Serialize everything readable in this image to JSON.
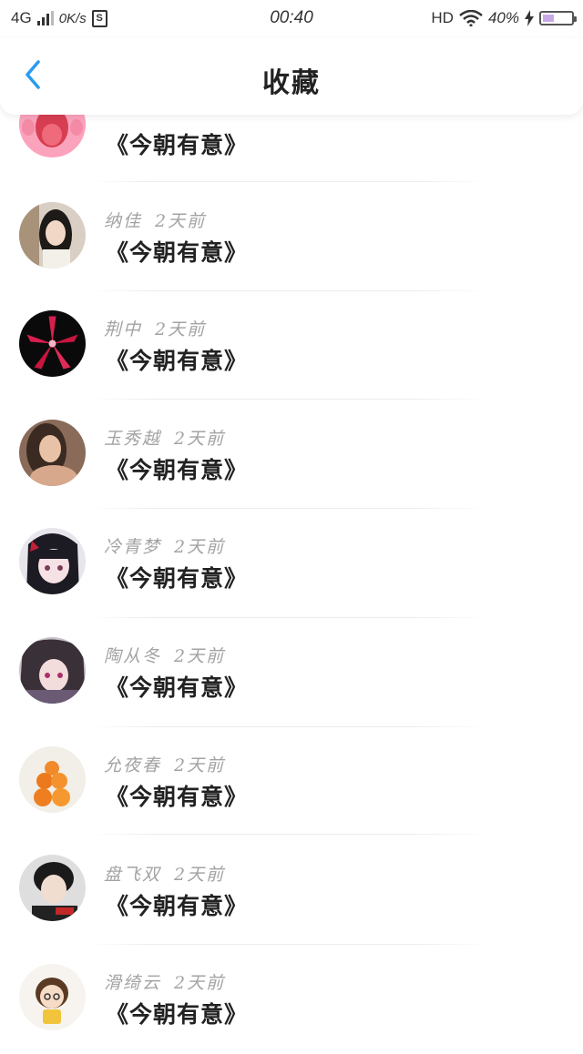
{
  "status_bar": {
    "network": "4G",
    "speed": "0K/s",
    "sim": "S",
    "time": "00:40",
    "hd": "HD",
    "battery": "40%",
    "battery_level": 0.4
  },
  "header": {
    "title": "收藏",
    "back_icon": "chevron-left-icon",
    "accent_color": "#2a9bf0"
  },
  "items": [
    {
      "user": "",
      "time": "",
      "title": "《今朝有意》",
      "avatar": "pink-round-character"
    },
    {
      "user": "纳佳",
      "time": "2天前",
      "title": "《今朝有意》",
      "avatar": "woman-portrait"
    },
    {
      "user": "荆中",
      "time": "2天前",
      "title": "《今朝有意》",
      "avatar": "red-lily-flower"
    },
    {
      "user": "玉秀越",
      "time": "2天前",
      "title": "《今朝有意》",
      "avatar": "woman-portrait"
    },
    {
      "user": "冷青梦",
      "time": "2天前",
      "title": "《今朝有意》",
      "avatar": "anime-girl"
    },
    {
      "user": "陶从冬",
      "time": "2天前",
      "title": "《今朝有意》",
      "avatar": "anime-girl"
    },
    {
      "user": "允夜春",
      "time": "2天前",
      "title": "《今朝有意》",
      "avatar": "oranges"
    },
    {
      "user": "盘飞双",
      "time": "2天前",
      "title": "《今朝有意》",
      "avatar": "boy-portrait"
    },
    {
      "user": "滑绮云",
      "time": "2天前",
      "title": "《今朝有意》",
      "avatar": "cartoon-girl"
    }
  ]
}
